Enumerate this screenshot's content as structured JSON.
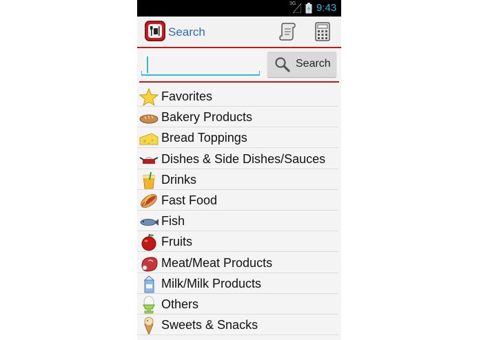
{
  "status_bar": {
    "network": "3G",
    "time": "9:43",
    "time_color": "#33b5e5"
  },
  "action_bar": {
    "title": "Search",
    "icon": "app-plate-icon",
    "actions": [
      "scroll-icon",
      "calculator-icon"
    ]
  },
  "search": {
    "placeholder": "",
    "value": "",
    "button_label": "Search",
    "button_icon": "search-icon"
  },
  "colors": {
    "accent_red": "#c11818",
    "title_blue": "#2d6bb5",
    "input_underline": "#33b5e5"
  },
  "categories": [
    {
      "label": "Favorites",
      "icon": "star-icon"
    },
    {
      "label": "Bakery Products",
      "icon": "bread-icon"
    },
    {
      "label": "Bread Toppings",
      "icon": "cheese-icon"
    },
    {
      "label": "Dishes & Side Dishes/Sauces",
      "icon": "pan-icon"
    },
    {
      "label": "Drinks",
      "icon": "drink-icon"
    },
    {
      "label": "Fast Food",
      "icon": "hotdog-icon"
    },
    {
      "label": "Fish",
      "icon": "fish-icon"
    },
    {
      "label": "Fruits",
      "icon": "apple-icon"
    },
    {
      "label": "Meat/Meat Products",
      "icon": "meat-icon"
    },
    {
      "label": "Milk/Milk Products",
      "icon": "milk-icon"
    },
    {
      "label": "Others",
      "icon": "egg-icon"
    },
    {
      "label": "Sweets & Snacks",
      "icon": "ice-cream-icon"
    }
  ]
}
